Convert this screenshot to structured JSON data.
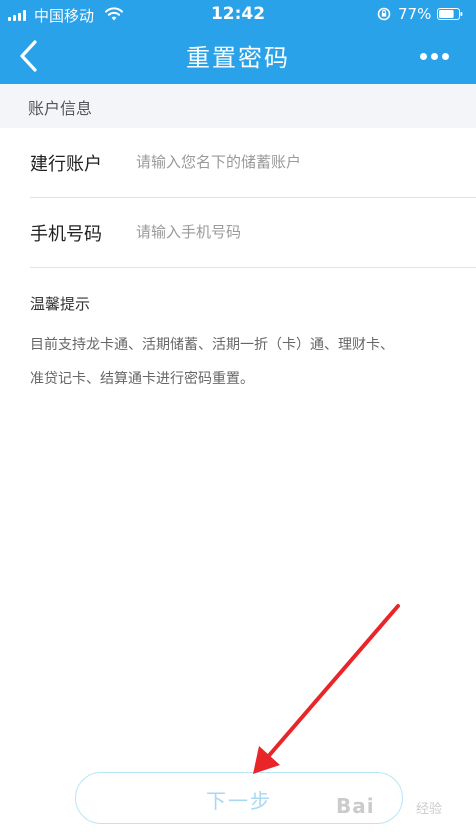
{
  "status_bar": {
    "carrier": "中国移动",
    "time": "12:42",
    "battery": "77%",
    "battery_level": 0.77
  },
  "nav": {
    "title": "重置密码",
    "back_icon": "chevron-left-icon",
    "more_icon": "ellipsis-icon"
  },
  "section": {
    "title": "账户信息"
  },
  "form": {
    "account": {
      "label": "建行账户",
      "placeholder": "请输入您名下的储蓄账户",
      "value": ""
    },
    "phone": {
      "label": "手机号码",
      "placeholder": "请输入手机号码",
      "value": ""
    }
  },
  "tips": {
    "title": "温馨提示",
    "lines": [
      "目前支持龙卡通、活期储蓄、活期一折（卡）通、理财卡、",
      "准贷记卡、结算通卡进行密码重置。"
    ]
  },
  "next_button": {
    "label": "下一步"
  },
  "watermark": {
    "text": "Bai",
    "sub": "经验"
  },
  "colors": {
    "header_bg": "#2aa2ea",
    "section_bg": "#f3f5f8",
    "button_text": "#a8d8f2",
    "button_border": "#b9e6f6",
    "annotation_arrow": "#e8262a"
  }
}
